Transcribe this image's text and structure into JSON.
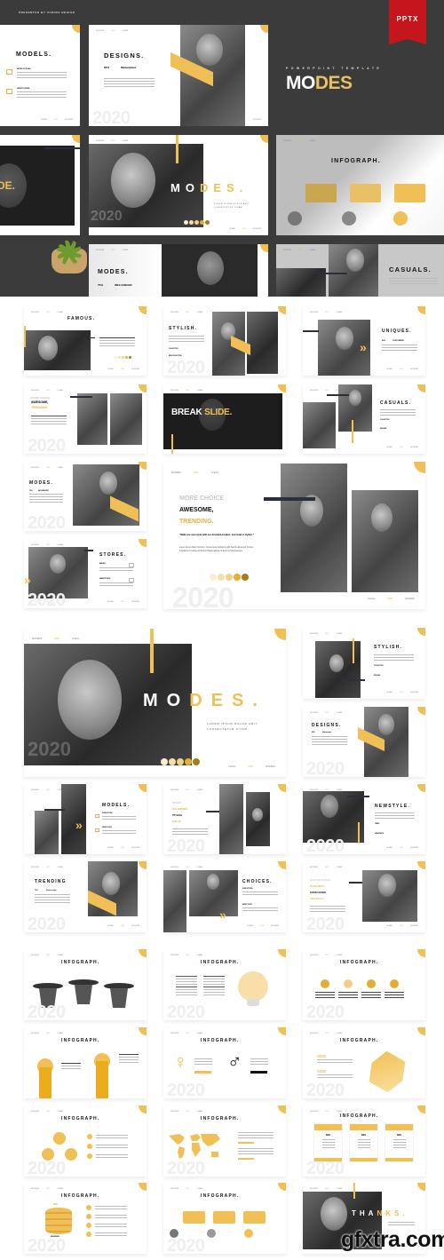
{
  "hero": {
    "presented_by": "PRESENTED BY VUNIRA DESIGN",
    "badge": "PPTX",
    "subtitle": "POWERPOINT TEMPLATE",
    "title_white": "MO",
    "title_yellow": "DES"
  },
  "nav": {
    "a": "MODERN",
    "b": "2020",
    "c": "CLEAN"
  },
  "fnav": {
    "a": "CLEAN",
    "b": "2020",
    "c": "MODERN"
  },
  "year": "2020",
  "colors": {
    "accent": "#f0bf55",
    "dark": "#3b3b3b",
    "badge": "#c4161c",
    "navy": "#2b2f3a"
  },
  "slides": {
    "models": {
      "title": "MODELS.",
      "item1": "MORE OPTIONS",
      "item2": "GREAT STORE"
    },
    "designs": {
      "title": "DESIGNS.",
      "stat": "65%",
      "stat_label": "Marketplace"
    },
    "de": {
      "title": "DE."
    },
    "modes_hero": {
      "m": "MO",
      "d": "DES.",
      "sub1": "LOREM IPSUM DOLOR AMIT.",
      "sub2": "CONSECTETUR SITAM."
    },
    "infograph1": {
      "title": "INFOGRAPH."
    },
    "modes2": {
      "title": "MODES.",
      "stat": "75%",
      "stat_label": "INFLUANCER"
    },
    "casuals1": {
      "title": "CASUALS."
    },
    "famous": {
      "title": "FAMOUS."
    },
    "stylish": {
      "title": "STYLISH.",
      "l1": "COLLECTION",
      "l2": "NEW COLLECTION"
    },
    "uniques": {
      "title": "UNIQUES.",
      "stat": "90%",
      "stat_label": "CUSTOMERS"
    },
    "awesome_small": {
      "l1": "MORE CHOICE",
      "l2": "AWESOME,",
      "l3": "TRENDING."
    },
    "break": {
      "w": "BREAK ",
      "y": "SLIDE."
    },
    "casuals2": {
      "title": "CASUALS.",
      "l1": "COLLECTION",
      "l2": "DESIGNS"
    },
    "modes3": {
      "title": "MODES.",
      "stat": "75%",
      "stat_label": "INFLUANCER"
    },
    "stores": {
      "title": "STORES.",
      "l1": "BRANDS",
      "l2": "MARKETPLACE"
    },
    "awesome_big": {
      "l1": "MORE CHOICE",
      "l2": "AWESOME,",
      "l3": "TRENDING.",
      "quote": "\"Make our own style with our branded product, and make it stylish.\"",
      "body": "Lorem Ipsum Dolor Sit Amet, Consectetur Adipiscing Elit Sed Do Eiusmod Tempor Incididunt Ut Labore Et Dolore Magna Aliqua Ut Enim Ad Da Eiusmod"
    },
    "modes_big": {
      "m": "MO",
      "d": "DES.",
      "sub1": "LOREM IPSUM DOLOR AMIT.",
      "sub2": "CONSECTETUR SITAM."
    },
    "stylish2": {
      "title": "STYLISH.",
      "l1": "COLLECTION",
      "l2": "DESIGNS"
    },
    "designs2": {
      "title": "DESIGNS.",
      "stat": "65%",
      "stat_label": "Marketplace"
    },
    "models2": {
      "title": "MODELS.",
      "l1": "MORE OPTIONS",
      "l2": "GREAT STORE"
    },
    "trendy": {
      "l1": "TRENDY",
      "l2": "THE AMAZING",
      "l3": "STYLISH,",
      "l4": "FOR US"
    },
    "newstyle": {
      "title": "NEWSTYLE.",
      "l1": "TREND",
      "l2": "FASHIONISTA"
    },
    "trending": {
      "title": "TRENDING",
      "stat": "70%",
      "stat_label": "Fashion Style"
    },
    "choices": {
      "title": "CHOICES.",
      "l1": "MORE OPTIONS",
      "l2": "GREAT STORE"
    },
    "collection": {
      "l1": "OUR COLLECTION",
      "l2": "IS THE BEST !",
      "l3": "GOOD CHOICE",
      "l4": "COLLECT IT !"
    },
    "info_titles": [
      "INFOGRAPH.",
      "INFOGRAPH.",
      "INFOGRAPH.",
      "INFOGRAPH.",
      "INFOGRAPH.",
      "INFOGRAPH.",
      "INFOGRAPH.",
      "INFOGRAPH.",
      "INFOGRAPH.",
      "INFOGRAPH.",
      "INFOGRAPH."
    ],
    "pricing": {
      "price": "$29",
      "header": "Your Subject"
    },
    "revenue": {
      "pct": "80%",
      "label": "REVENUE"
    },
    "thanks": {
      "w": "THA",
      "y": "NKS."
    }
  },
  "watermark": "gfxtra.com"
}
